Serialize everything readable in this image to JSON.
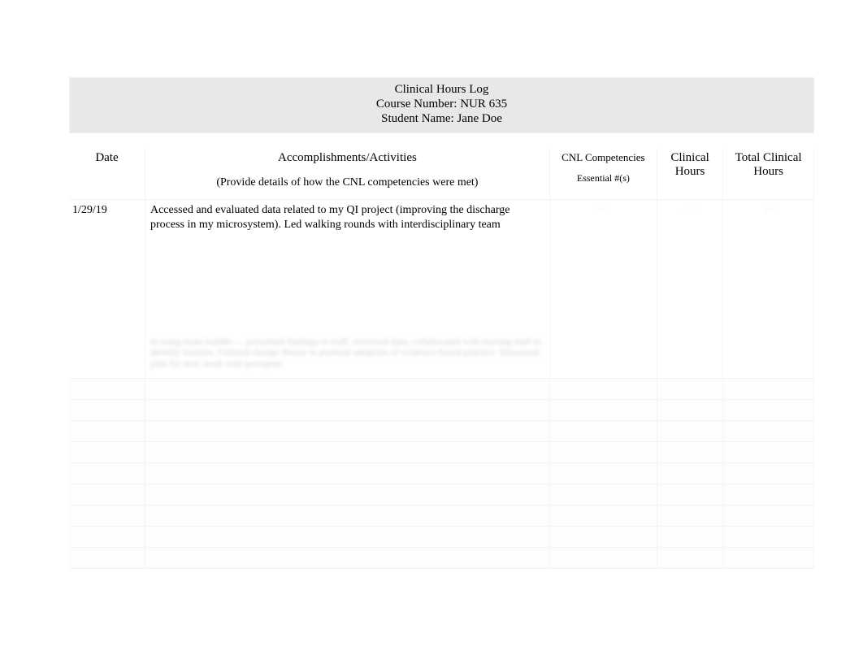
{
  "header": {
    "title": "Clinical Hours Log",
    "course_line": "Course Number: NUR 635",
    "student_line": "Student Name: Jane Doe"
  },
  "columns": {
    "date": "Date",
    "activities": "Accomplishments/Activities",
    "activities_sub": "(Provide details of how the CNL competencies were met)",
    "cnl": "CNL Competencies",
    "cnl_sub": "Essential #(s)",
    "clinical_hours": "Clinical Hours",
    "total_clinical_hours": "Total Clinical Hours"
  },
  "rows": [
    {
      "date": "1/29/19",
      "activities_clear": "Accessed and evaluated data related to my QI project (improving the discharge process in my microsystem). Led walking rounds with interdisciplinary team",
      "activities_blur": "in using team huddle — presented findings to staff, reviewed data, collaborated with nursing staff to identify barriers. Utilized change theory to promote adoption of evidence-based practice. Discussed plan for next week with preceptor.",
      "cnl": "—",
      "clinical_hours": "—",
      "total_clinical_hours": "—"
    }
  ],
  "empty_row_count": 9
}
